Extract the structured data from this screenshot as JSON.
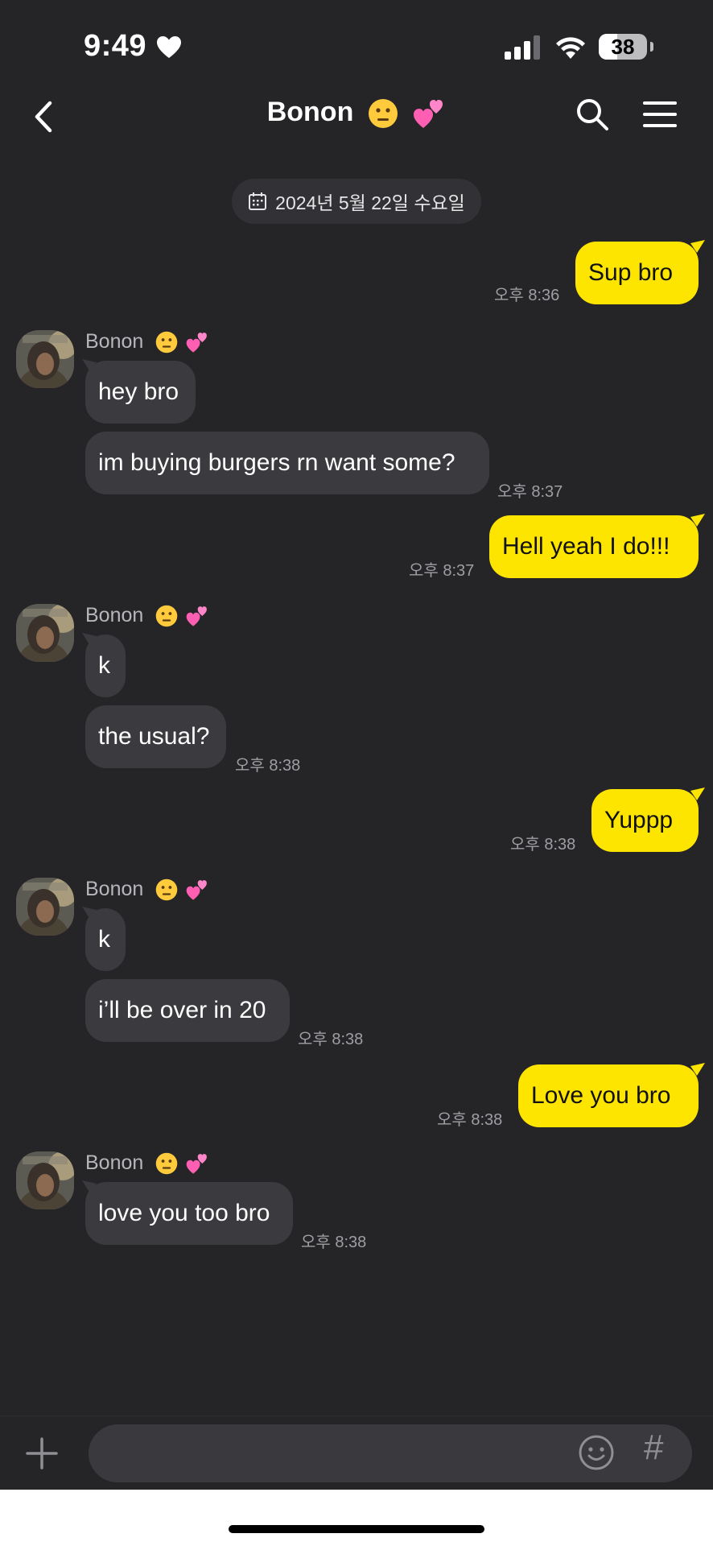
{
  "status_bar": {
    "time": "9:49",
    "battery": "38"
  },
  "header": {
    "title": "Bonon"
  },
  "date_label": "2024년 5월 22일 수요일",
  "sender_name": "Bonon",
  "messages": [
    {
      "from": "me",
      "text": "Sup bro",
      "time": "오후 8:36"
    },
    {
      "from": "them",
      "text": "hey bro",
      "time": ""
    },
    {
      "from": "them",
      "text": "im buying burgers rn want some?",
      "time": "오후 8:37"
    },
    {
      "from": "me",
      "text": "Hell yeah I do!!!",
      "time": "오후 8:37"
    },
    {
      "from": "them",
      "text": "k",
      "time": ""
    },
    {
      "from": "them",
      "text": "the usual?",
      "time": "오후 8:38"
    },
    {
      "from": "me",
      "text": "Yuppp",
      "time": "오후 8:38"
    },
    {
      "from": "them",
      "text": "k",
      "time": ""
    },
    {
      "from": "them",
      "text": "i’ll be over in 20",
      "time": "오후 8:38"
    },
    {
      "from": "me",
      "text": "Love you bro",
      "time": "오후 8:38"
    },
    {
      "from": "them",
      "text": "love you too bro",
      "time": "오후 8:38"
    }
  ],
  "input": {
    "placeholder": ""
  },
  "colors": {
    "my_bubble": "#fee500",
    "their_bubble": "#3b3b3f",
    "background": "#252528"
  }
}
